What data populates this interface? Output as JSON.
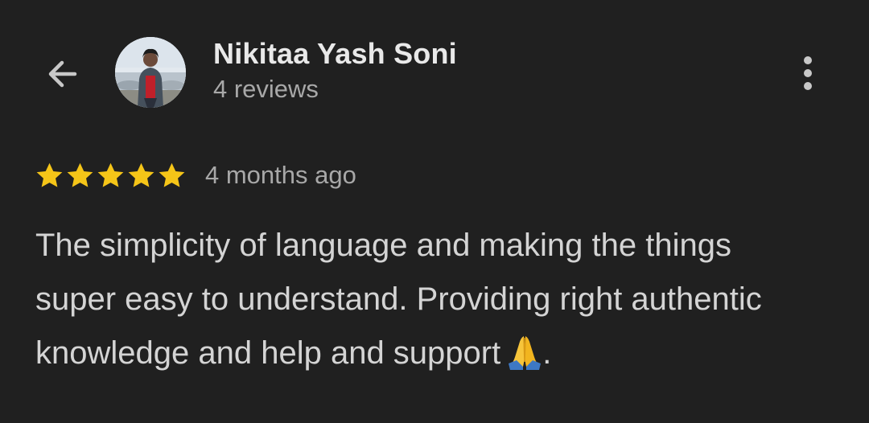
{
  "header": {
    "reviewer_name": "Nikitaa Yash Soni",
    "review_count": "4 reviews",
    "back_icon": "arrow-back-icon",
    "more_icon": "more-vert-icon",
    "avatar_icon": "person-avatar"
  },
  "review": {
    "rating": 5,
    "max_rating": 5,
    "star_color": "#f5c518",
    "date": "4 months ago",
    "lines": [
      "The simplicity of language and making the things",
      "super easy to understand. Providing right authentic",
      "knowledge and help and support"
    ],
    "emoji": "folded-hands-icon",
    "trailing": "."
  },
  "colors": {
    "background": "#202020",
    "primary_text": "#e9e9e9",
    "secondary_text": "#a8a8a8",
    "body_text": "#d4d4d4"
  }
}
